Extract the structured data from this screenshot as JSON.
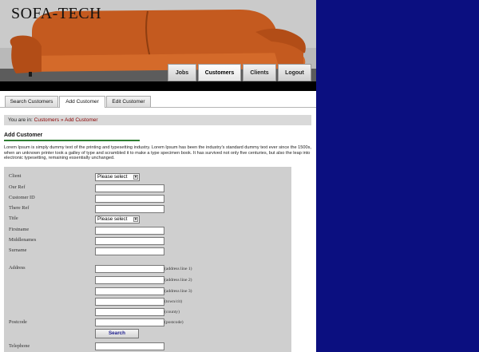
{
  "brand": {
    "title": "SOFA-TECH"
  },
  "nav": {
    "tabs": [
      {
        "label": "Jobs"
      },
      {
        "label": "Customers"
      },
      {
        "label": "Clients"
      },
      {
        "label": "Logout"
      }
    ],
    "active": "Customers"
  },
  "subtabs": [
    {
      "label": "Search Customers"
    },
    {
      "label": "Add Customer"
    },
    {
      "label": "Edit Customer"
    }
  ],
  "breadcrumb": {
    "prefix": "You are in:",
    "link1": "Customers",
    "separator": "»",
    "link2": "Add Customer"
  },
  "section": {
    "title": "Add Customer",
    "intro": "Lorem Ipsum is simply dummy text of the printing and typesetting industry. Lorem Ipsum has been the industry's standard dummy text ever since the 1500s, when an unknown printer took a galley of type and scrambled it to make a type specimen book. It has survived not only five centuries, but also the leap into electronic typesetting, remaining essentially unchanged."
  },
  "form": {
    "client_label": "Client",
    "client_select": "Please select",
    "our_ref_label": "Our Ref",
    "customer_id_label": "Customer ID",
    "their_ref_label": "There Ref",
    "title_label": "Title",
    "title_select": "Please select",
    "firstname_label": "Firstname",
    "middlenames_label": "Middlenames",
    "surname_label": "Surname",
    "address_label": "Address",
    "address_hints": [
      "(address line 1)",
      "(address line 2)",
      "(address line 3)",
      "(town/cit)",
      "(county)",
      "(postcode)"
    ],
    "postcode_label": "Postcode",
    "search_button": "Search",
    "telephone_label": "Telephone"
  },
  "colors": {
    "right_background": "#0b0f80",
    "breadcrumb_link": "#8b0000",
    "section_underline": "#2e7d32"
  }
}
